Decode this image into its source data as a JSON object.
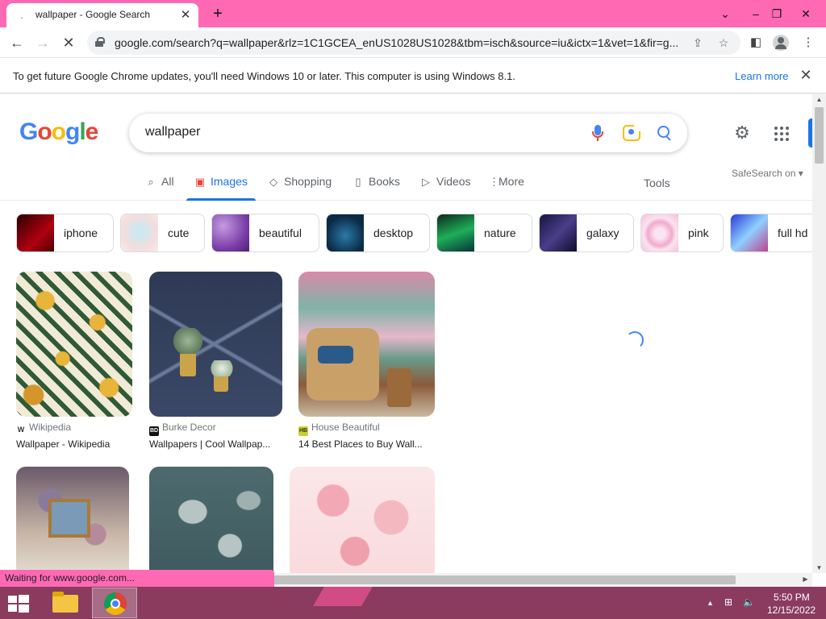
{
  "browser": {
    "tab_title": "wallpaper - Google Search",
    "tab_favicon": "loading-dot-icon",
    "new_tab": "+",
    "url": "google.com/search?q=wallpaper&rlz=1C1GCEA_enUS1028US1028&tbm=isch&source=iu&ictx=1&vet=1&fir=g...",
    "status_text": "Waiting for www.google.com...",
    "accent_color": "#ff69b4"
  },
  "infobar": {
    "message": "To get future Google Chrome updates, you'll need Windows 10 or later. This computer is using Windows 8.1.",
    "link": "Learn more"
  },
  "search": {
    "logo_letters": [
      "G",
      "o",
      "o",
      "g",
      "l",
      "e"
    ],
    "query": "wallpaper",
    "tabs": [
      {
        "label": "All",
        "icon": "search-icon"
      },
      {
        "label": "Images",
        "icon": "image-icon",
        "active": true
      },
      {
        "label": "Shopping",
        "icon": "tag-icon"
      },
      {
        "label": "Books",
        "icon": "book-icon"
      },
      {
        "label": "Videos",
        "icon": "video-icon"
      },
      {
        "label": "More",
        "icon": "more-vert-icon"
      }
    ],
    "tools": "Tools",
    "safesearch": "SafeSearch on"
  },
  "chips": [
    "iphone",
    "cute",
    "beautiful",
    "desktop",
    "nature",
    "galaxy",
    "pink",
    "full hd"
  ],
  "results": [
    {
      "source": "Wikipedia",
      "favicon": "W",
      "title": "Wallpaper - Wikipedia"
    },
    {
      "source": "Burke Decor",
      "favicon": "BD",
      "title": "Wallpapers | Cool Wallpap..."
    },
    {
      "source": "House Beautiful",
      "favicon": "HB",
      "title": "14 Best Places to Buy Wall..."
    }
  ],
  "taskbar": {
    "time": "5:50 PM",
    "date": "12/15/2022",
    "color": "#8a3b5e"
  }
}
